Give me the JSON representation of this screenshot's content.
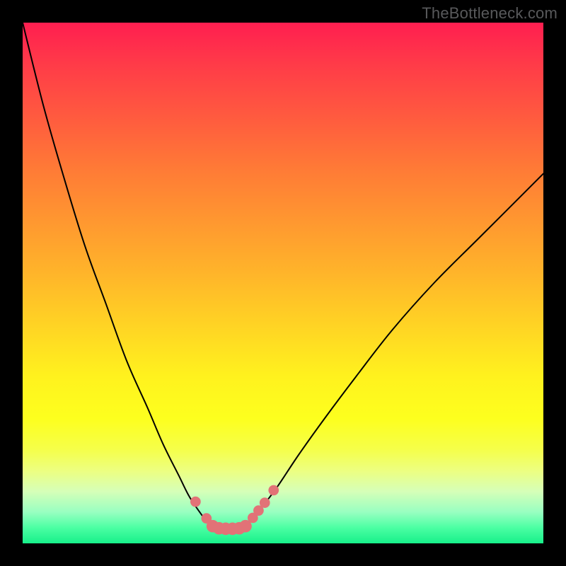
{
  "watermark": "TheBottleneck.com",
  "colors": {
    "background": "#000000",
    "curve": "#000000",
    "marker_fill": "#e27277",
    "marker_stroke": "#e27277",
    "gradient_top": "#ff1e50",
    "gradient_bottom": "#17f08a"
  },
  "chart_data": {
    "type": "line",
    "title": "",
    "xlabel": "",
    "ylabel": "",
    "xlim": [
      0,
      100
    ],
    "ylim": [
      0,
      100
    ],
    "grid": false,
    "legend": false,
    "series": [
      {
        "name": "left-branch",
        "x": [
          0,
          4,
          8,
          12,
          16,
          20,
          24,
          27,
          30,
          32,
          34,
          35.5,
          36.3
        ],
        "y": [
          100,
          84,
          70,
          57,
          46,
          35,
          26,
          19,
          13,
          9,
          6,
          4,
          3.2
        ]
      },
      {
        "name": "right-branch",
        "x": [
          42.6,
          44,
          46,
          49,
          53,
          58,
          64,
          71,
          79,
          88,
          100
        ],
        "y": [
          3.2,
          4.5,
          7,
          11,
          17,
          24,
          32,
          41,
          50,
          59,
          71
        ]
      },
      {
        "name": "base-segment",
        "x": [
          36.3,
          37.2,
          38.5,
          40,
          41.5,
          42.6
        ],
        "y": [
          3.2,
          2.8,
          2.6,
          2.6,
          2.8,
          3.2
        ]
      }
    ],
    "markers": [
      {
        "x": 33.2,
        "y": 8.0,
        "r": 1.0
      },
      {
        "x": 35.3,
        "y": 4.8,
        "r": 1.0
      },
      {
        "x": 36.5,
        "y": 3.3,
        "r": 1.2
      },
      {
        "x": 37.7,
        "y": 2.9,
        "r": 1.2
      },
      {
        "x": 39.0,
        "y": 2.8,
        "r": 1.2
      },
      {
        "x": 40.3,
        "y": 2.8,
        "r": 1.2
      },
      {
        "x": 41.6,
        "y": 2.9,
        "r": 1.2
      },
      {
        "x": 42.8,
        "y": 3.3,
        "r": 1.2
      },
      {
        "x": 44.2,
        "y": 4.9,
        "r": 1.0
      },
      {
        "x": 45.3,
        "y": 6.3,
        "r": 1.0
      },
      {
        "x": 46.5,
        "y": 7.8,
        "r": 1.0
      },
      {
        "x": 48.2,
        "y": 10.2,
        "r": 1.0
      }
    ]
  }
}
